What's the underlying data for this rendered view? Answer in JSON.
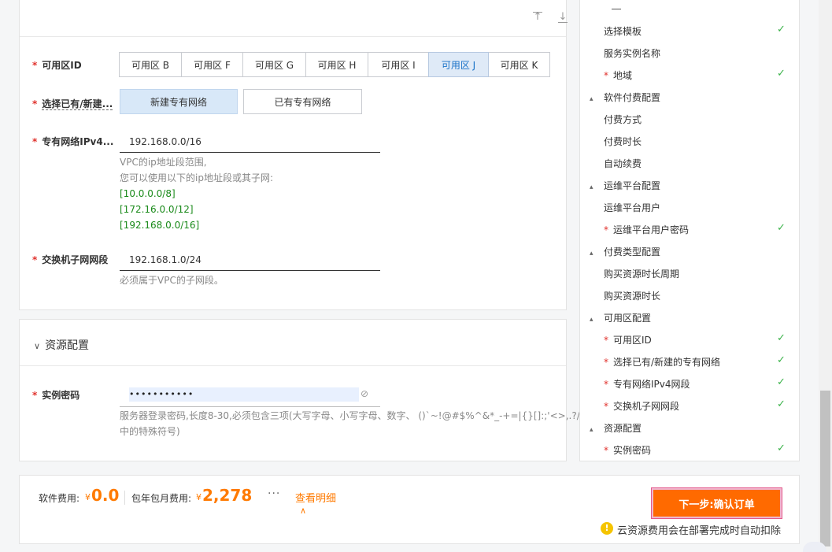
{
  "form": {
    "az": {
      "label": "可用区ID",
      "options": [
        "可用区 B",
        "可用区 F",
        "可用区 G",
        "可用区 H",
        "可用区 I",
        "可用区 J",
        "可用区 K"
      ],
      "selected": "可用区 J"
    },
    "vpc_choice": {
      "label": "选择已有/新建...",
      "new_label": "新建专有网络",
      "existing_label": "已有专有网络",
      "selected": "新建专有网络"
    },
    "vpc_cidr": {
      "label": "专有网络IPv4...",
      "value": "192.168.0.0/16",
      "help1": "VPC的ip地址段范围,",
      "help2": "您可以使用以下的ip地址段或其子网:",
      "ranges": [
        "[10.0.0.0/8]",
        "[172.16.0.0/12]",
        "[192.168.0.0/16]"
      ]
    },
    "vswitch": {
      "label": "交换机子网网段",
      "value": "192.168.1.0/24",
      "help": "必须属于VPC的子网段。"
    }
  },
  "resource": {
    "title": "资源配置",
    "password_label": "实例密码",
    "password_value": "•••••••••••",
    "help1": "服务器登录密码,长度8-30,必须包含三项(大写字母、小写字母、数字、 ()`~!@#$%^&*_-+=|{}[]:;'<>,.?/",
    "help2": "中的特殊符号)"
  },
  "nav": [
    {
      "text": "选择模板",
      "type": "item",
      "required": false,
      "checked": true
    },
    {
      "text": "服务实例名称",
      "type": "item",
      "required": false,
      "checked": false
    },
    {
      "text": "地域",
      "type": "item",
      "required": true,
      "checked": true
    },
    {
      "text": "软件付费配置",
      "type": "section"
    },
    {
      "text": "付费方式",
      "type": "item",
      "required": false,
      "checked": false
    },
    {
      "text": "付费时长",
      "type": "item",
      "required": false,
      "checked": false
    },
    {
      "text": "自动续费",
      "type": "item",
      "required": false,
      "checked": false
    },
    {
      "text": "运维平台配置",
      "type": "section"
    },
    {
      "text": "运维平台用户",
      "type": "item",
      "required": false,
      "checked": false
    },
    {
      "text": "运维平台用户密码",
      "type": "item",
      "required": true,
      "checked": true
    },
    {
      "text": "付费类型配置",
      "type": "section"
    },
    {
      "text": "购买资源时长周期",
      "type": "item",
      "required": false,
      "checked": false
    },
    {
      "text": "购买资源时长",
      "type": "item",
      "required": false,
      "checked": false
    },
    {
      "text": "可用区配置",
      "type": "section"
    },
    {
      "text": "可用区ID",
      "type": "item",
      "required": true,
      "checked": true
    },
    {
      "text": "选择已有/新建的专有网络",
      "type": "item",
      "required": true,
      "checked": true
    },
    {
      "text": "专有网络IPv4网段",
      "type": "item",
      "required": true,
      "checked": true
    },
    {
      "text": "交换机子网网段",
      "type": "item",
      "required": true,
      "checked": true
    },
    {
      "text": "资源配置",
      "type": "section"
    },
    {
      "text": "实例密码",
      "type": "item",
      "required": true,
      "checked": true
    }
  ],
  "footer": {
    "software_fee_label": "软件费用:",
    "software_fee_currency": "¥",
    "software_fee_value": "0.0",
    "subscription_fee_label": "包年包月费用:",
    "subscription_fee_currency": "¥",
    "subscription_fee_value": "2,278",
    "more": "···",
    "detail_link": "查看明细",
    "next_button": "下一步:确认订单",
    "notice": "云资源费用会在部署完成时自动扣除"
  },
  "colors": {
    "accent": "#ff6a00",
    "required": "#e0302b",
    "check": "#3bb34a",
    "selected_tab": "#1a73c8"
  }
}
